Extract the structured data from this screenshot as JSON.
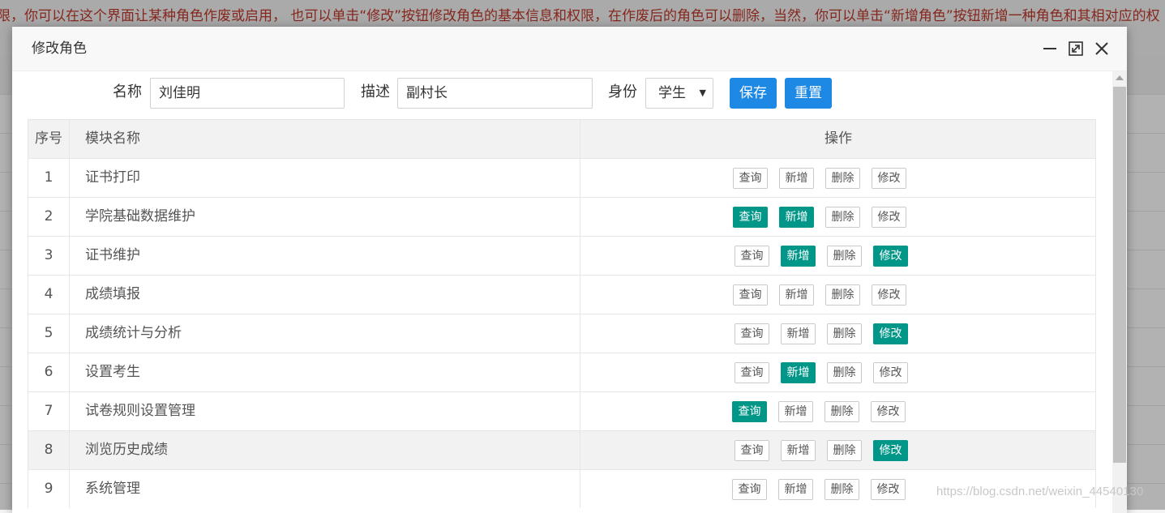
{
  "background": {
    "hint_text": "限，你可以在这个界面让某种角色作废或启用， 也可以单击“修改”按钮修改角色的基本信息和权限，在作废后的角色可以删除，当然，你可以单击“新增角色”按钮新增一种角色和其相对应的权"
  },
  "modal": {
    "title": "修改角色",
    "header_icons": [
      "minimize-icon",
      "maximize-icon",
      "close-icon"
    ]
  },
  "form": {
    "name_label": "名称",
    "name_value": "刘佳明",
    "desc_label": "描述",
    "desc_value": "副村长",
    "identity_label": "身份",
    "identity_value": "学生",
    "save_label": "保存",
    "reset_label": "重置"
  },
  "table": {
    "headers": {
      "index": "序号",
      "name": "模块名称",
      "ops": "操作"
    },
    "op_labels": {
      "query": "查询",
      "add": "新增",
      "delete": "删除",
      "edit": "修改"
    },
    "rows": [
      {
        "index": "1",
        "name": "证书打印",
        "query": false,
        "add": false,
        "delete": false,
        "edit": false
      },
      {
        "index": "2",
        "name": "学院基础数据维护",
        "query": true,
        "add": true,
        "delete": false,
        "edit": false
      },
      {
        "index": "3",
        "name": "证书维护",
        "query": false,
        "add": true,
        "delete": false,
        "edit": true
      },
      {
        "index": "4",
        "name": "成绩填报",
        "query": false,
        "add": false,
        "delete": false,
        "edit": false
      },
      {
        "index": "5",
        "name": "成绩统计与分析",
        "query": false,
        "add": false,
        "delete": false,
        "edit": true
      },
      {
        "index": "6",
        "name": "设置考生",
        "query": false,
        "add": true,
        "delete": false,
        "edit": false
      },
      {
        "index": "7",
        "name": "试卷规则设置管理",
        "query": true,
        "add": false,
        "delete": false,
        "edit": false
      },
      {
        "index": "8",
        "name": "浏览历史成绩",
        "query": false,
        "add": false,
        "delete": false,
        "edit": true
      },
      {
        "index": "9",
        "name": "系统管理",
        "query": false,
        "add": false,
        "delete": false,
        "edit": false
      }
    ]
  },
  "colors": {
    "primary_blue": "#1e88e5",
    "checked_green": "#009688"
  },
  "watermark": "https://blog.csdn.net/weixin_44540130"
}
